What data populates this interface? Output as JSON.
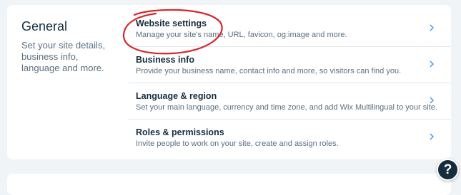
{
  "general": {
    "title": "General",
    "description": "Set your site details, business info, language and more."
  },
  "rows": [
    {
      "title": "Website settings",
      "description": "Manage your site's name, URL, favicon, og:image and more."
    },
    {
      "title": "Business info",
      "description": "Provide your business name, contact info and more, so visitors can find you."
    },
    {
      "title": "Language & region",
      "description": "Set your main language, currency and time zone, and add Wix Multilingual to your site."
    },
    {
      "title": "Roles & permissions",
      "description": "Invite people to work on your site, create and assign roles."
    }
  ],
  "help": {
    "label": "?"
  },
  "colors": {
    "accent_annotation": "#d7262b",
    "heading": "#162d3d",
    "muted": "#5b6f80",
    "chevron": "#3899ec"
  }
}
